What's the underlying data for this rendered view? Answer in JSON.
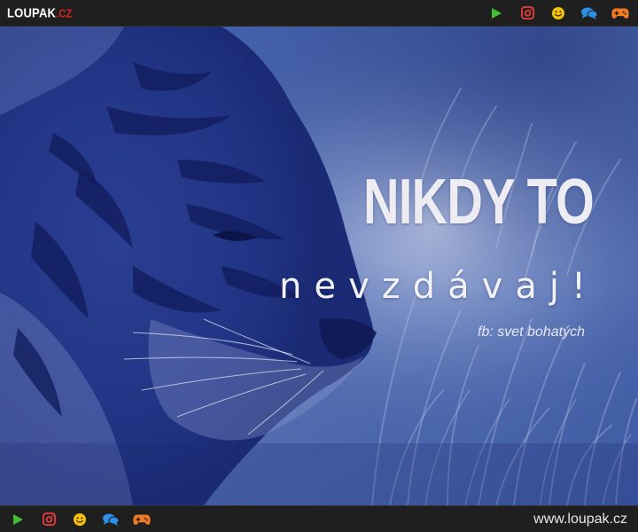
{
  "header": {
    "logo_text": "LOUPAK",
    "logo_tld": ".CZ",
    "icons": [
      "play-icon",
      "instagram-icon",
      "smiley-icon",
      "chat-icon",
      "gamepad-icon"
    ]
  },
  "image": {
    "headline": "NIKDY TO",
    "subline": "nevzdávaj!",
    "credit": "fb: svet bohatých"
  },
  "footer": {
    "icons": [
      "play-icon",
      "instagram-icon",
      "smiley-icon",
      "chat-icon",
      "gamepad-icon"
    ],
    "site_url": "www.loupak.cz"
  },
  "colors": {
    "bar_background": "#1f1f1f",
    "logo_accent": "#e02222",
    "play_icon": "#3fbf2f",
    "instagram_icon": "#e23b3b",
    "smiley_icon": "#f4c20d",
    "chat_icon": "#2f8fe6",
    "gamepad_icon": "#f07a22",
    "image_tint": "#2f4a92"
  }
}
